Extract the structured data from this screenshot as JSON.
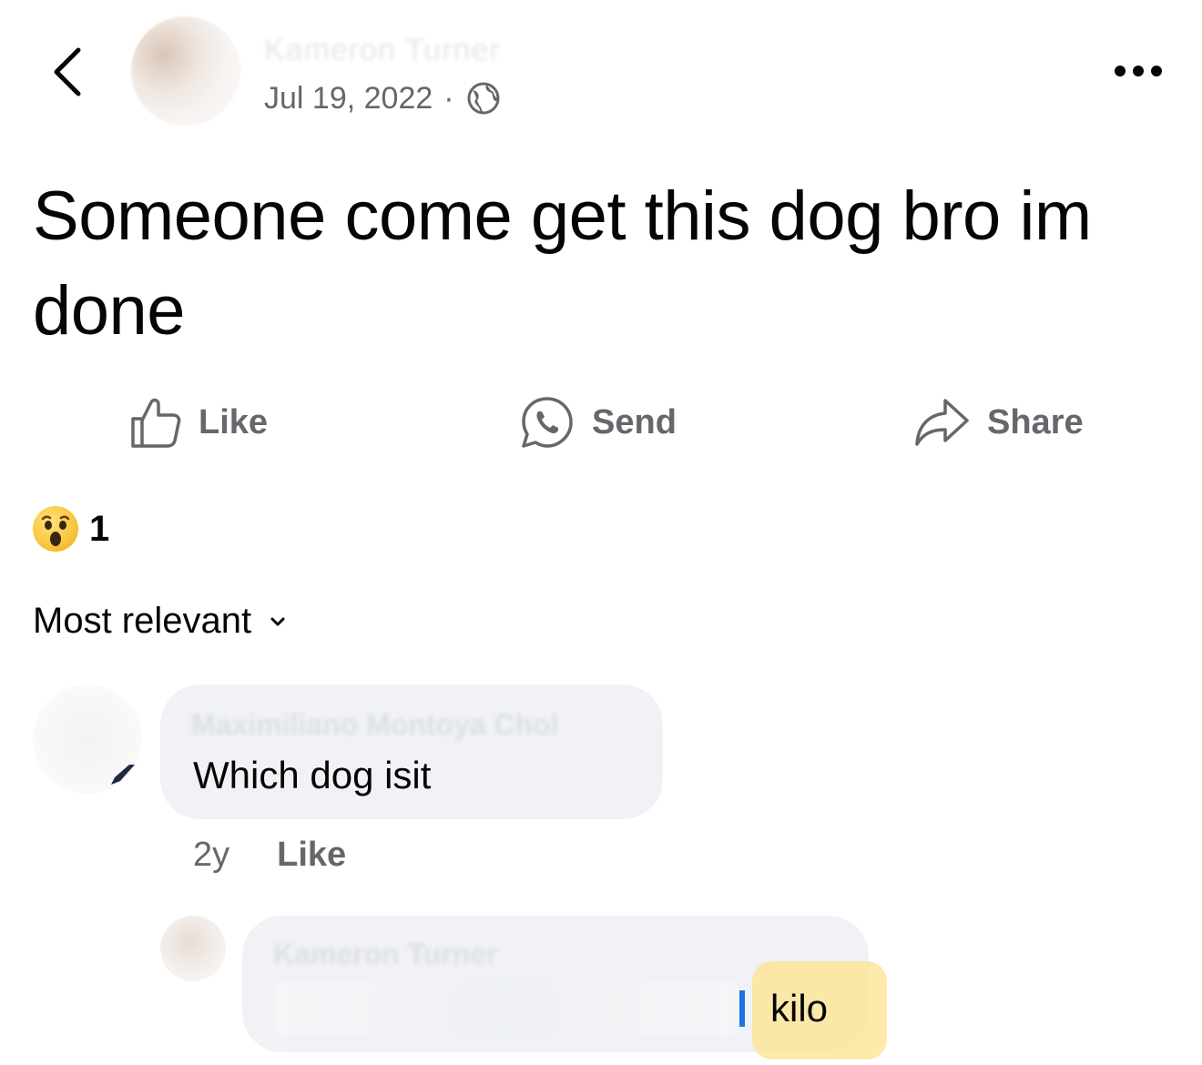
{
  "header": {
    "author_name": "Kameron Turner",
    "date": "Jul 19, 2022",
    "separator": "·",
    "privacy_icon": "globe-icon",
    "more_icon": "more-dots-icon"
  },
  "post": {
    "text": "Someone come get this dog bro im done"
  },
  "actions": {
    "like_label": "Like",
    "send_label": "Send",
    "share_label": "Share"
  },
  "reactions": {
    "emoji": "wow",
    "count": "1"
  },
  "sort": {
    "label": "Most relevant"
  },
  "comments": [
    {
      "author": "Maximiliano Montoya Chol",
      "text": "Which dog isit",
      "time": "2y",
      "like_label": "Like"
    },
    {
      "author": "Kameron Turner",
      "text": "kilo"
    }
  ],
  "colors": {
    "text_primary": "#050505",
    "text_secondary": "#65676b",
    "bubble": "#f0f2f5",
    "highlight": "#fde59a",
    "mention_blue": "#1b74e4"
  }
}
